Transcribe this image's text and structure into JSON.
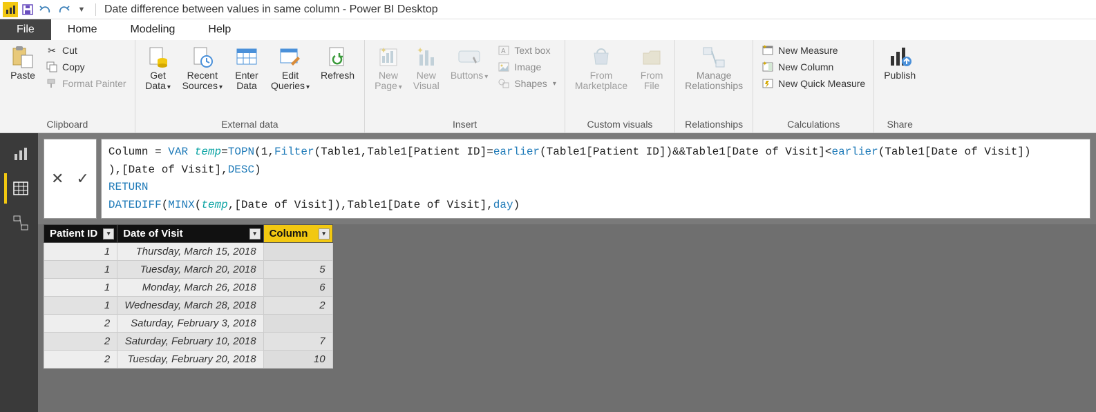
{
  "titlebar": {
    "app_badge": "📊",
    "doc_title": "Date difference between values in same column - Power BI Desktop"
  },
  "menutabs": {
    "file": "File",
    "home": "Home",
    "modeling": "Modeling",
    "help": "Help"
  },
  "ribbon": {
    "clipboard": {
      "label": "Clipboard",
      "paste": "Paste",
      "cut": "Cut",
      "copy": "Copy",
      "format_painter": "Format Painter"
    },
    "external_data": {
      "label": "External data",
      "get_data": "Get\nData",
      "recent_sources": "Recent\nSources",
      "enter_data": "Enter\nData",
      "edit_queries": "Edit\nQueries",
      "refresh": "Refresh"
    },
    "insert": {
      "label": "Insert",
      "new_page": "New\nPage",
      "new_visual": "New\nVisual",
      "buttons": "Buttons",
      "text_box": "Text box",
      "image": "Image",
      "shapes": "Shapes"
    },
    "custom_visuals": {
      "label": "Custom visuals",
      "from_marketplace": "From\nMarketplace",
      "from_file": "From\nFile"
    },
    "relationships": {
      "label": "Relationships",
      "manage": "Manage\nRelationships"
    },
    "calculations": {
      "label": "Calculations",
      "new_measure": "New Measure",
      "new_column": "New Column",
      "new_quick_measure": "New Quick Measure"
    },
    "share": {
      "label": "Share",
      "publish": "Publish"
    }
  },
  "formula": {
    "line1_a": "Column = ",
    "line1_kw_var": "VAR",
    "line1_space": " ",
    "line1_var": "temp",
    "line1_b": "=",
    "line1_fn1": "TOPN",
    "line1_c": "(1,",
    "line1_fn2": "Filter",
    "line1_d": "(Table1,Table1[Patient ID]=",
    "line1_fn3": "earlier",
    "line1_e": "(Table1[Patient ID])&&Table1[Date of Visit]<",
    "line1_fn4": "earlier",
    "line1_f": "(Table1[Date of Visit])",
    "line2_a": "),[Date of Visit],",
    "line2_kw": "DESC",
    "line2_b": ")",
    "line3_kw": "RETURN",
    "line4_fn1": "DATEDIFF",
    "line4_a": "(",
    "line4_fn2": "MINX",
    "line4_b": "(",
    "line4_var": "temp",
    "line4_c": ",[Date of Visit]),Table1[Date of Visit],",
    "line4_kw": "day",
    "line4_d": ")"
  },
  "grid": {
    "headers": {
      "c1": "Patient ID",
      "c2": "Date of Visit",
      "c3": "Column"
    },
    "rows": [
      {
        "pid": "1",
        "date": "Thursday, March 15, 2018",
        "col": ""
      },
      {
        "pid": "1",
        "date": "Tuesday, March 20, 2018",
        "col": "5"
      },
      {
        "pid": "1",
        "date": "Monday, March 26, 2018",
        "col": "6"
      },
      {
        "pid": "1",
        "date": "Wednesday, March 28, 2018",
        "col": "2"
      },
      {
        "pid": "2",
        "date": "Saturday, February 3, 2018",
        "col": ""
      },
      {
        "pid": "2",
        "date": "Saturday, February 10, 2018",
        "col": "7"
      },
      {
        "pid": "2",
        "date": "Tuesday, February 20, 2018",
        "col": "10"
      }
    ]
  }
}
